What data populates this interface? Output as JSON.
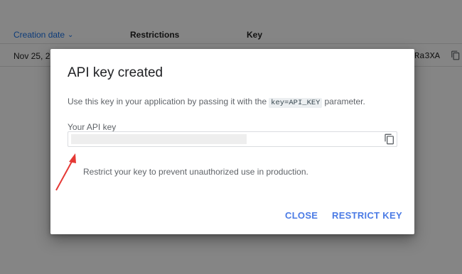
{
  "table": {
    "headers": {
      "creation_date": "Creation date",
      "restrictions": "Restrictions",
      "key": "Key"
    },
    "row": {
      "date": "Nov 25, 2",
      "key_suffix": "Ra3XA"
    }
  },
  "dialog": {
    "title": "API key created",
    "desc_before": "Use this key in your application by passing it with the",
    "desc_code": "key=API_KEY",
    "desc_after": "parameter.",
    "key_label": "Your API key",
    "key_value": "",
    "restrict_message": "Restrict your key to prevent unauthorized use in production.",
    "close_label": "CLOSE",
    "restrict_label": "RESTRICT KEY"
  },
  "colors": {
    "accent": "#4b7be5",
    "annotation_arrow": "#e53935"
  },
  "icons": {
    "sort": "chevron-down-icon",
    "copy": "copy-icon"
  }
}
